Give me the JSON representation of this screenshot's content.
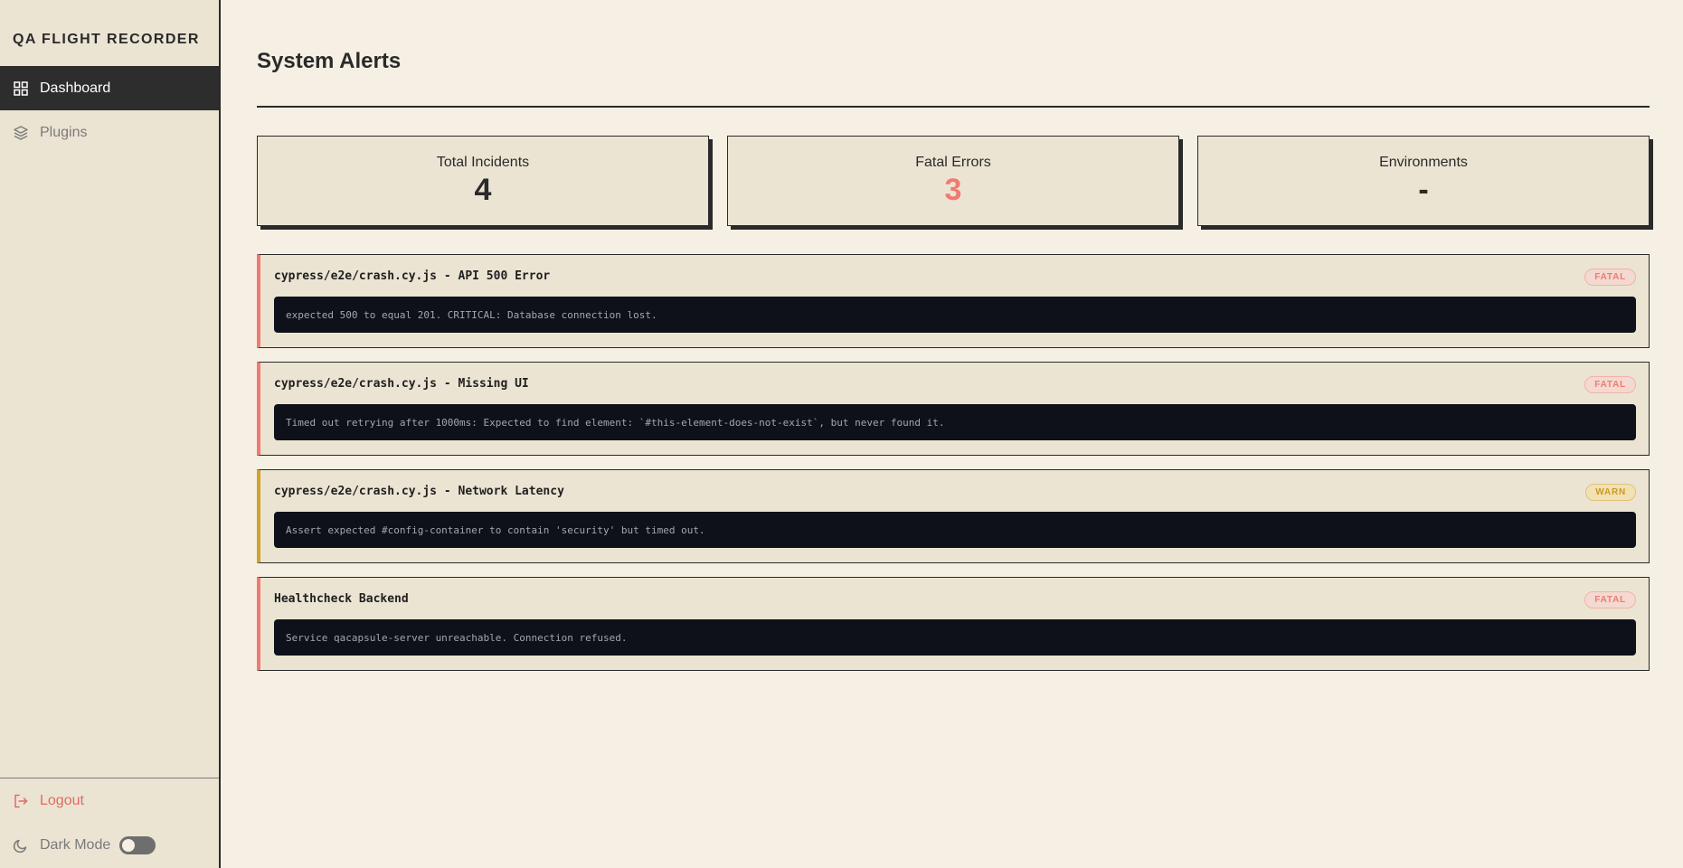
{
  "app": {
    "brand": "QA FLIGHT RECORDER"
  },
  "sidebar": {
    "items": [
      {
        "label": "Dashboard",
        "icon": "grid-icon",
        "active": true
      },
      {
        "label": "Plugins",
        "icon": "layers-icon",
        "active": false
      }
    ],
    "logout_label": "Logout",
    "darkmode_label": "Dark Mode",
    "darkmode_on": false
  },
  "main": {
    "title": "System Alerts",
    "stats": [
      {
        "label": "Total Incidents",
        "value": "4"
      },
      {
        "label": "Fatal Errors",
        "value": "3"
      },
      {
        "label": "Environments",
        "value": "-"
      }
    ],
    "alerts": [
      {
        "title": "cypress/e2e/crash.cy.js - API 500 Error",
        "level": "FATAL",
        "message": "expected 500 to equal 201. CRITICAL: Database connection lost."
      },
      {
        "title": "cypress/e2e/crash.cy.js - Missing UI",
        "level": "FATAL",
        "message": "Timed out retrying after 1000ms: Expected to find element: `#this-element-does-not-exist`, but never found it."
      },
      {
        "title": "cypress/e2e/crash.cy.js - Network Latency",
        "level": "WARN",
        "message": "Assert expected #config-container to contain 'security' but timed out."
      },
      {
        "title": "Healthcheck Backend",
        "level": "FATAL",
        "message": "Service qacapsule-server unreachable. Connection refused."
      }
    ]
  },
  "colors": {
    "background": "#f5f0e3",
    "sidebar": "#ebe4d3",
    "fatal": "#f07b72",
    "warn": "#d4a12a",
    "console": "#0e1119"
  }
}
